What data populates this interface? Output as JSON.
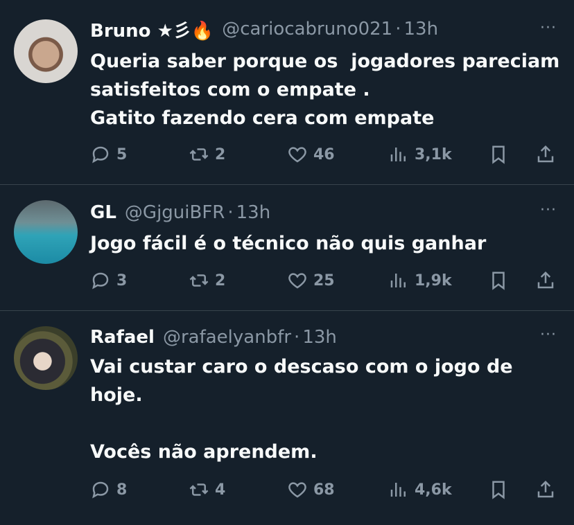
{
  "tweets": [
    {
      "name": "Bruno ★彡🔥",
      "handle": "@cariocabruno021",
      "dot": "·",
      "time": "13h",
      "text": "Queria saber porque os  jogadores pareciam\nsatisfeitos com o empate .\nGatito fazendo cera com empate",
      "replies": "5",
      "retweets": "2",
      "likes": "46",
      "views": "3,1k"
    },
    {
      "name": "GL",
      "handle": "@GjguiBFR",
      "dot": "·",
      "time": "13h",
      "text": "Jogo fácil é o técnico não quis ganhar",
      "replies": "3",
      "retweets": "2",
      "likes": "25",
      "views": "1,9k"
    },
    {
      "name": "Rafael",
      "handle": "@rafaelyanbfr",
      "dot": "·",
      "time": "13h",
      "text": "Vai custar caro o descaso com o jogo de\nhoje.\n\nVocês não aprendem.",
      "replies": "8",
      "retweets": "4",
      "likes": "68",
      "views": "4,6k"
    }
  ],
  "more_label": "···",
  "colors": {
    "background": "#15202b",
    "muted": "#8b98a5",
    "divider": "#38444d"
  }
}
